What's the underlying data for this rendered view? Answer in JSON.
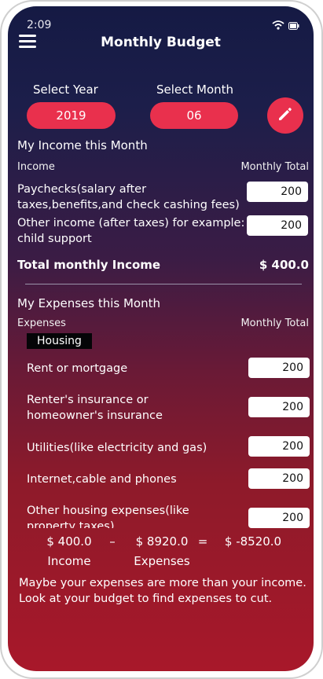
{
  "status": {
    "time": "2:09"
  },
  "header": {
    "title": "Monthly Budget"
  },
  "selectors": {
    "year_label": "Select Year",
    "year_value": "2019",
    "month_label": "Select Month",
    "month_value": "06"
  },
  "income": {
    "section_title": "My Income this Month",
    "col_left": "Income",
    "col_right": "Monthly Total",
    "rows": [
      {
        "label_line1": "Paychecks(salary after",
        "label_line2": "taxes,benefits,and check cashing fees)",
        "value": "200"
      },
      {
        "label_line1": "Other income (after taxes) for example:",
        "label_line2": "child support",
        "value": "200"
      }
    ],
    "total_label": "Total monthly Income",
    "total_value": "$ 400.0"
  },
  "expenses": {
    "section_title": "My Expenses this Month",
    "col_left": "Expenses",
    "col_right": "Monthly Total",
    "category": "Housing",
    "rows": [
      {
        "label_line1": "Rent or mortgage",
        "label_line2": "",
        "value": "200"
      },
      {
        "label_line1": "Renter's insurance or",
        "label_line2": "homeowner's insurance",
        "value": "200"
      },
      {
        "label_line1": "Utilities(like electricity and gas)",
        "label_line2": "",
        "value": "200"
      },
      {
        "label_line1": "Internet,cable and phones",
        "label_line2": "",
        "value": "200"
      },
      {
        "label_line1": "Other housing expenses(like",
        "label_line2": "property taxes)",
        "value": "200"
      }
    ]
  },
  "summary": {
    "income_value": "$ 400.0",
    "minus": "–",
    "expenses_value": "$ 8920.0",
    "equals": "=",
    "result_value": "$ -8520.0",
    "income_label": "Income",
    "expenses_label": "Expenses",
    "message_line1": "Maybe your expenses are more than your income.",
    "message_line2": "Look at your budget to find expenses to cut."
  },
  "colors": {
    "accent": "#e9304d",
    "bg_top": "#151a44",
    "bg_bottom": "#a8182a"
  },
  "icons": {
    "menu": "hamburger-icon",
    "edit": "pencil-icon"
  }
}
